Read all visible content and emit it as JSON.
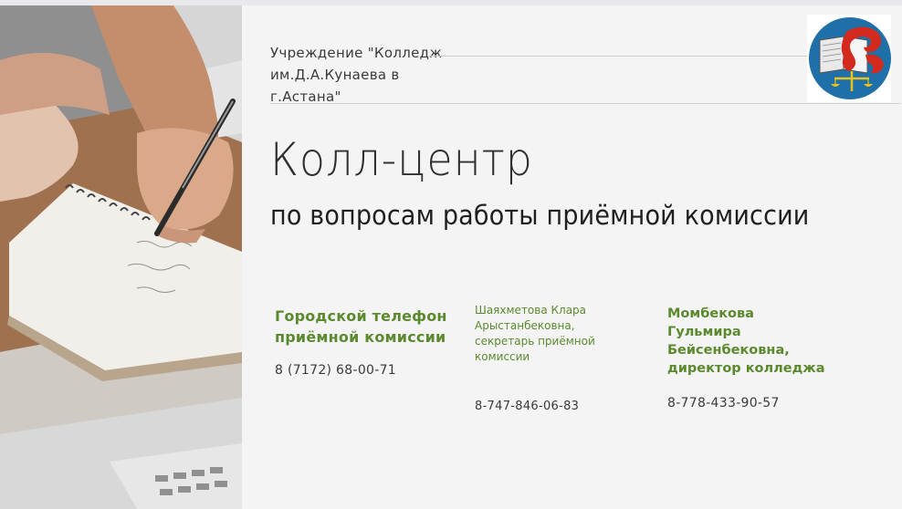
{
  "header": {
    "institution": "Учреждение \"Колледж им.Д.А.Кунаева в г.Астана\""
  },
  "main": {
    "title": "Колл-центр",
    "subtitle": "по вопросам работы приёмной комиссии"
  },
  "contacts": [
    {
      "heading": "Городской телефон приёмной комиссии",
      "phone": "8 (7172) 68-00-71"
    },
    {
      "heading": "Шаяхметова Клара Арыстанбековна, секретарь приёмной комиссии",
      "phone": "8-747-846-06-83"
    },
    {
      "heading": "Момбекова Гульмира Бейсенбековна, директор колледжа",
      "phone": "8-778-433-90-57"
    }
  ],
  "images": {
    "photo": "hand-writing-in-notebook-photo",
    "logo": "college-emblem-logo"
  },
  "colors": {
    "accent_green": "#5b8a2e",
    "logo_blue": "#1f6fa8",
    "logo_red": "#d42a1e",
    "logo_gold": "#e8c21c"
  }
}
